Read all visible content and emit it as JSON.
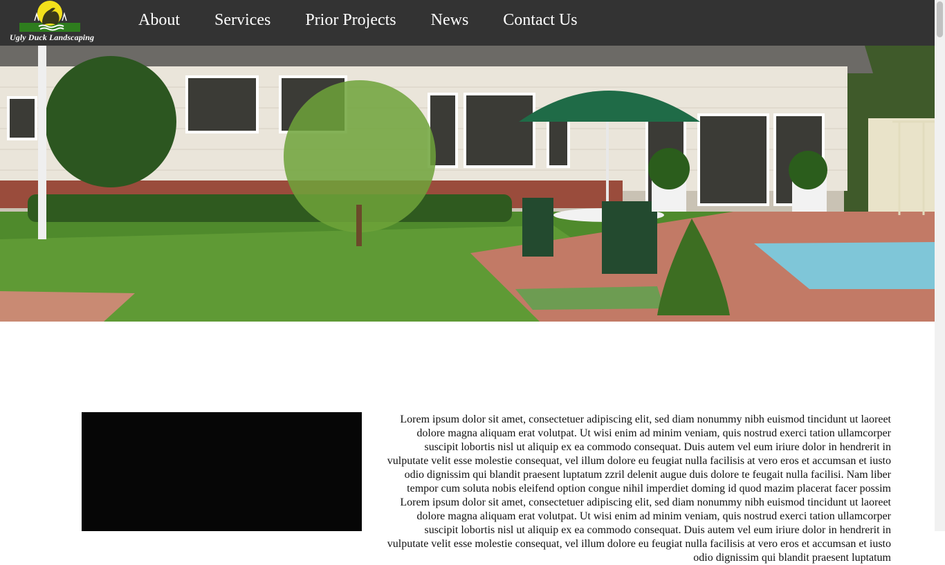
{
  "header": {
    "logo_text": "Ugly Duck Landscaping",
    "nav": [
      {
        "label": "About"
      },
      {
        "label": "Services"
      },
      {
        "label": "Prior Projects"
      },
      {
        "label": "News"
      },
      {
        "label": "Contact Us"
      }
    ]
  },
  "hero": {
    "image": "backyard-patio-with-umbrella-lawn-and-pool-photo"
  },
  "content": {
    "body_text": "Lorem ipsum dolor sit amet, consectetuer adipiscing elit, sed diam nonummy nibh euismod tincidunt ut laoreet dolore magna aliquam erat volutpat. Ut wisi enim ad minim veniam, quis nostrud exerci tation ullamcorper suscipit lobortis nisl ut aliquip ex ea commodo consequat. Duis autem vel eum iriure dolor in hendrerit in vulputate velit esse molestie consequat, vel illum dolore eu feugiat nulla facilisis at vero eros et accumsan et iusto odio dignissim qui blandit praesent luptatum zzril delenit augue duis dolore te feugait nulla facilisi. Nam liber tempor cum soluta nobis eleifend option congue nihil imperdiet doming id quod mazim placerat facer possim Lorem ipsum dolor sit amet, consectetuer adipiscing elit, sed diam nonummy nibh euismod tincidunt ut laoreet dolore magna aliquam erat volutpat. Ut wisi enim ad minim veniam, quis nostrud exerci tation ullamcorper suscipit lobortis nisl ut aliquip ex ea commodo consequat. Duis autem vel eum iriure dolor in hendrerit in vulputate velit esse molestie consequat, vel illum dolore eu feugiat nulla facilisis at vero eros et accumsan et iusto odio dignissim qui blandit praesent luptatum"
  },
  "colors": {
    "header_bg": "#333333",
    "logo_sun": "#f3e11b",
    "logo_grass": "#2e7d1e",
    "nav_text": "#ffffff"
  }
}
